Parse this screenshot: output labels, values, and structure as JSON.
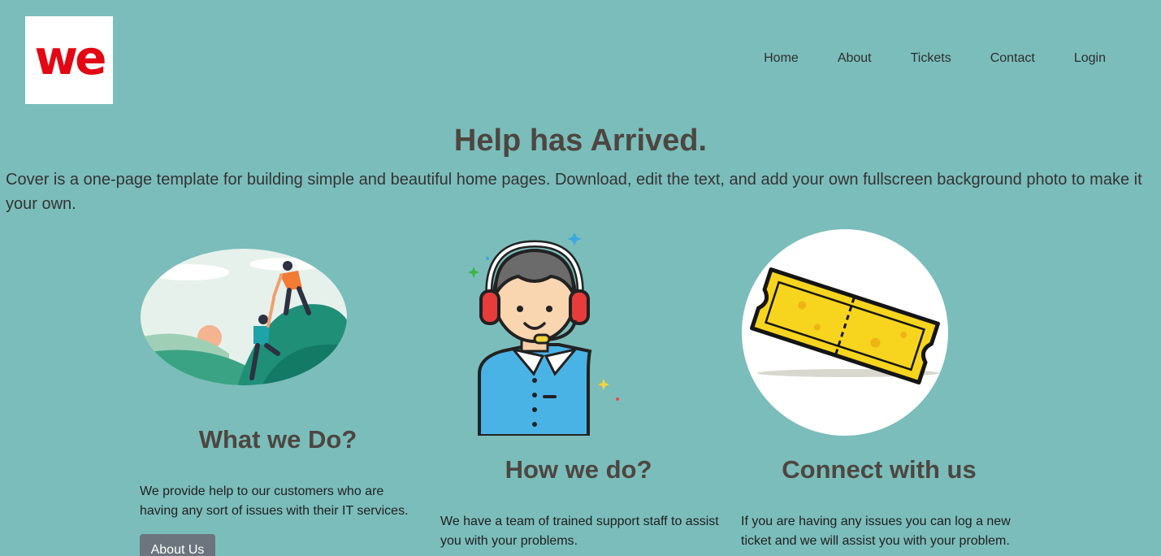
{
  "brand": {
    "logo_text": "we",
    "logo_color": "#e30613"
  },
  "nav": {
    "items": [
      "Home",
      "About",
      "Tickets",
      "Contact",
      "Login"
    ]
  },
  "hero": {
    "title": "Help has Arrived.",
    "lead": "Cover is a one-page template for building simple and beautiful home pages. Download, edit the text, and add your own fullscreen background photo to make it your own."
  },
  "columns": [
    {
      "image": "climbing-help-illustration",
      "title": "What we Do?",
      "text": "We provide help to our customers who are having any sort of issues with their IT services.",
      "button": "About Us"
    },
    {
      "image": "support-agent-headset-icon",
      "title": "How we do?",
      "text": "We have a team of trained support staff to assist you with your problems."
    },
    {
      "image": "yellow-ticket-illustration",
      "title": "Connect with us",
      "text": "If you are having any issues you can log a new ticket and we will assist you with your problem."
    }
  ],
  "colors": {
    "background": "#7bbdbb",
    "heading": "#4d4640",
    "button": "#6c757d"
  }
}
